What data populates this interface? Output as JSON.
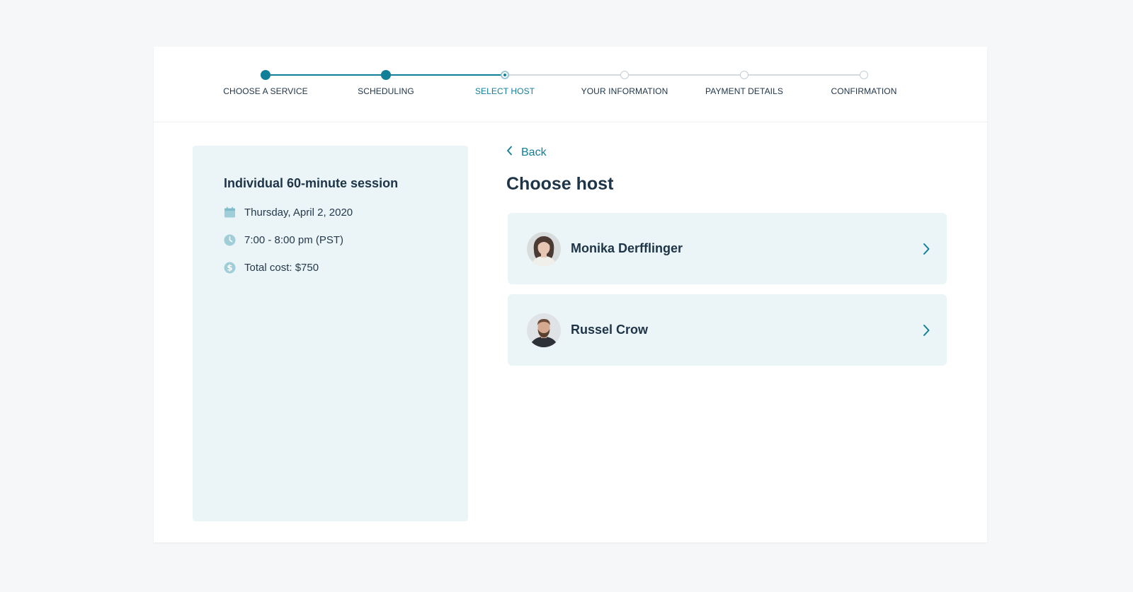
{
  "stepper": {
    "steps": [
      {
        "label": "CHOOSE A SERVICE",
        "state": "done"
      },
      {
        "label": "SCHEDULING",
        "state": "done"
      },
      {
        "label": "SELECT HOST",
        "state": "active"
      },
      {
        "label": "YOUR INFORMATION",
        "state": "todo"
      },
      {
        "label": "PAYMENT DETAILS",
        "state": "todo"
      },
      {
        "label": "CONFIRMATION",
        "state": "todo"
      }
    ]
  },
  "summary": {
    "title": "Individual 60-minute session",
    "date": "Thursday, April 2, 2020",
    "time": "7:00 - 8:00 pm (PST)",
    "cost": "Total cost: $750",
    "icons": [
      "calendar-icon",
      "clock-icon",
      "dollar-icon"
    ]
  },
  "main": {
    "back_label": "Back",
    "heading": "Choose host",
    "hosts": [
      {
        "name": "Monika Derfflinger"
      },
      {
        "name": "Russel Crow"
      }
    ]
  },
  "colors": {
    "accent": "#127f98",
    "panel": "#ebf5f7",
    "background": "#f5f7f9",
    "text": "#1e3447"
  }
}
